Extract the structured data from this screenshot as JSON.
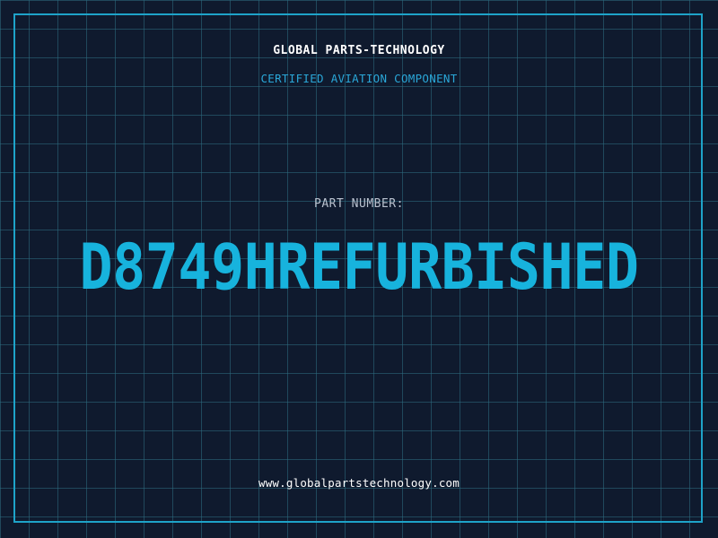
{
  "header": {
    "company_name": "GLOBAL PARTS-TECHNOLOGY",
    "subtitle": "CERTIFIED AVIATION COMPONENT"
  },
  "part": {
    "label": "PART NUMBER:",
    "number": "D8749HREFURBISHED"
  },
  "footer": {
    "website": "www.globalpartstechnology.com"
  },
  "colors": {
    "background": "#0f1a2e",
    "grid": "#2d6e82",
    "accent": "#17b3dd",
    "frame": "#1ea3c9"
  }
}
